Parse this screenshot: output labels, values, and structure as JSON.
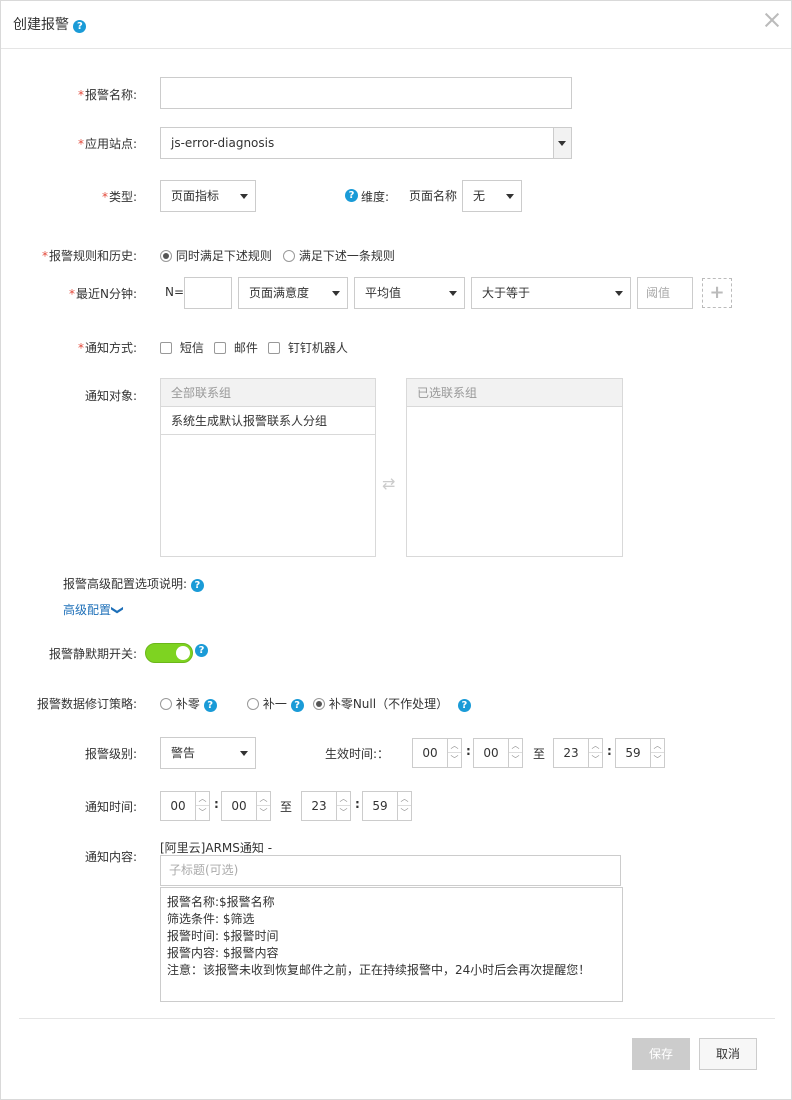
{
  "header": {
    "title": "创建报警",
    "help_icon": "?"
  },
  "form": {
    "alert_name": {
      "label": "报警名称:",
      "value": ""
    },
    "app_site": {
      "label": "应用站点:",
      "value": "js-error-diagnosis"
    },
    "type": {
      "label": "类型:",
      "value": "页面指标"
    },
    "dimension": {
      "label": "维度:",
      "name": "页面名称",
      "value": "无"
    },
    "rules": {
      "label": "报警规则和历史:",
      "option1": "同时满足下述规则",
      "option2": "满足下述一条规则"
    },
    "recent": {
      "label": "最近N分钟:",
      "n_prefix": "N=",
      "n_value": "",
      "metric": "页面满意度",
      "agg": "平均值",
      "cmp": "大于等于",
      "threshold_placeholder": "阈值",
      "plus": "+"
    },
    "notify_method": {
      "label": "通知方式:",
      "sms": "短信",
      "mail": "邮件",
      "dingtalk": "钉钉机器人"
    },
    "notify_target": {
      "label": "通知对象:",
      "all_groups": "全部联系组",
      "selected_groups": "已选联系组",
      "items": [
        "系统生成默认报警联系人分组"
      ],
      "transfer_icon": "⇄"
    },
    "advanced": {
      "desc_label": "报警高级配置选项说明:",
      "link": "高级配置",
      "chevron": "❯"
    },
    "silence": {
      "label": "报警静默期开关:"
    },
    "repair": {
      "label": "报警数据修订策略:",
      "opt1": "补零",
      "opt2": "补一",
      "opt3": "补零Null（不作处理）"
    },
    "level": {
      "label": "报警级别:",
      "value": "警告"
    },
    "effective": {
      "label": "生效时间:：",
      "h1": "00",
      "m1": "00",
      "to": "至",
      "h2": "23",
      "m2": "59",
      "colon": ":"
    },
    "notify_time": {
      "label": "通知时间:",
      "h1": "00",
      "m1": "00",
      "to": "至",
      "h2": "23",
      "m2": "59",
      "colon": ":"
    },
    "content": {
      "label": "通知内容:",
      "prefix": "[阿里云]ARMS通知 -",
      "subtitle_placeholder": "子标题(可选)",
      "body": "报警名称:$报警名称\n筛选条件: $筛选\n报警时间: $报警时间\n报警内容: $报警内容\n注意：该报警未收到恢复邮件之前，正在持续报警中，24小时后会再次提醒您！"
    }
  },
  "footer": {
    "save": "保存",
    "cancel": "取消"
  },
  "colors": {
    "accent": "#1a9bd7",
    "required": "#e3493a",
    "toggle_on": "#7ed321",
    "link": "#1d6fb8"
  }
}
